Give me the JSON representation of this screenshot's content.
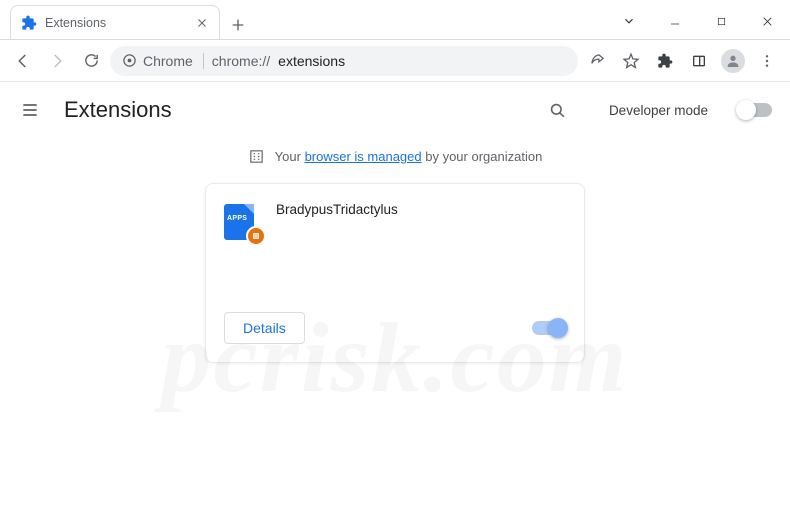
{
  "window": {
    "tab_title": "Extensions",
    "favicon_name": "extension-puzzle"
  },
  "omnibox": {
    "scheme_label": "Chrome",
    "url_prefix": "chrome://",
    "url_bold": "extensions"
  },
  "page": {
    "title": "Extensions",
    "dev_mode_label": "Developer mode",
    "dev_mode_on": false
  },
  "managed_banner": {
    "prefix": "Your ",
    "link_text": "browser is managed",
    "suffix": " by your organization"
  },
  "extension_card": {
    "name": "BradypusTridactylus",
    "icon_label": "APPS",
    "details_label": "Details",
    "enabled": true
  },
  "watermark": "pcrisk.com"
}
